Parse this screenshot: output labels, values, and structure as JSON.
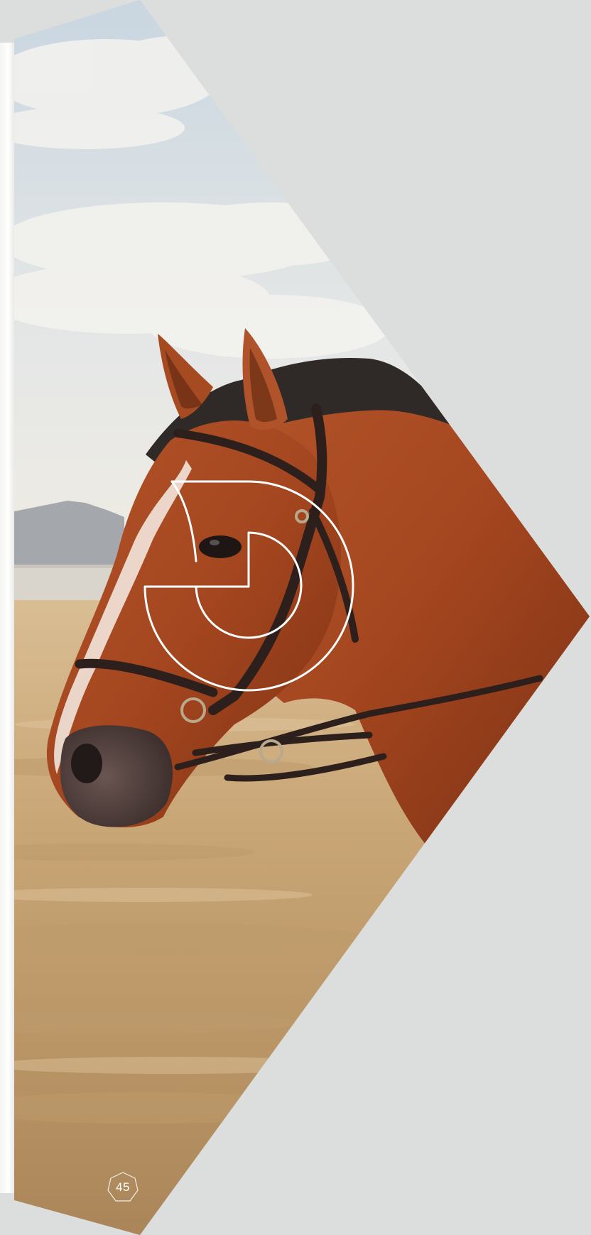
{
  "page": {
    "number": "45",
    "background_color": "#dcdddd"
  },
  "photo": {
    "subject_icon": "horse-photo",
    "logo_icon": "d-mark-logo-outline"
  }
}
